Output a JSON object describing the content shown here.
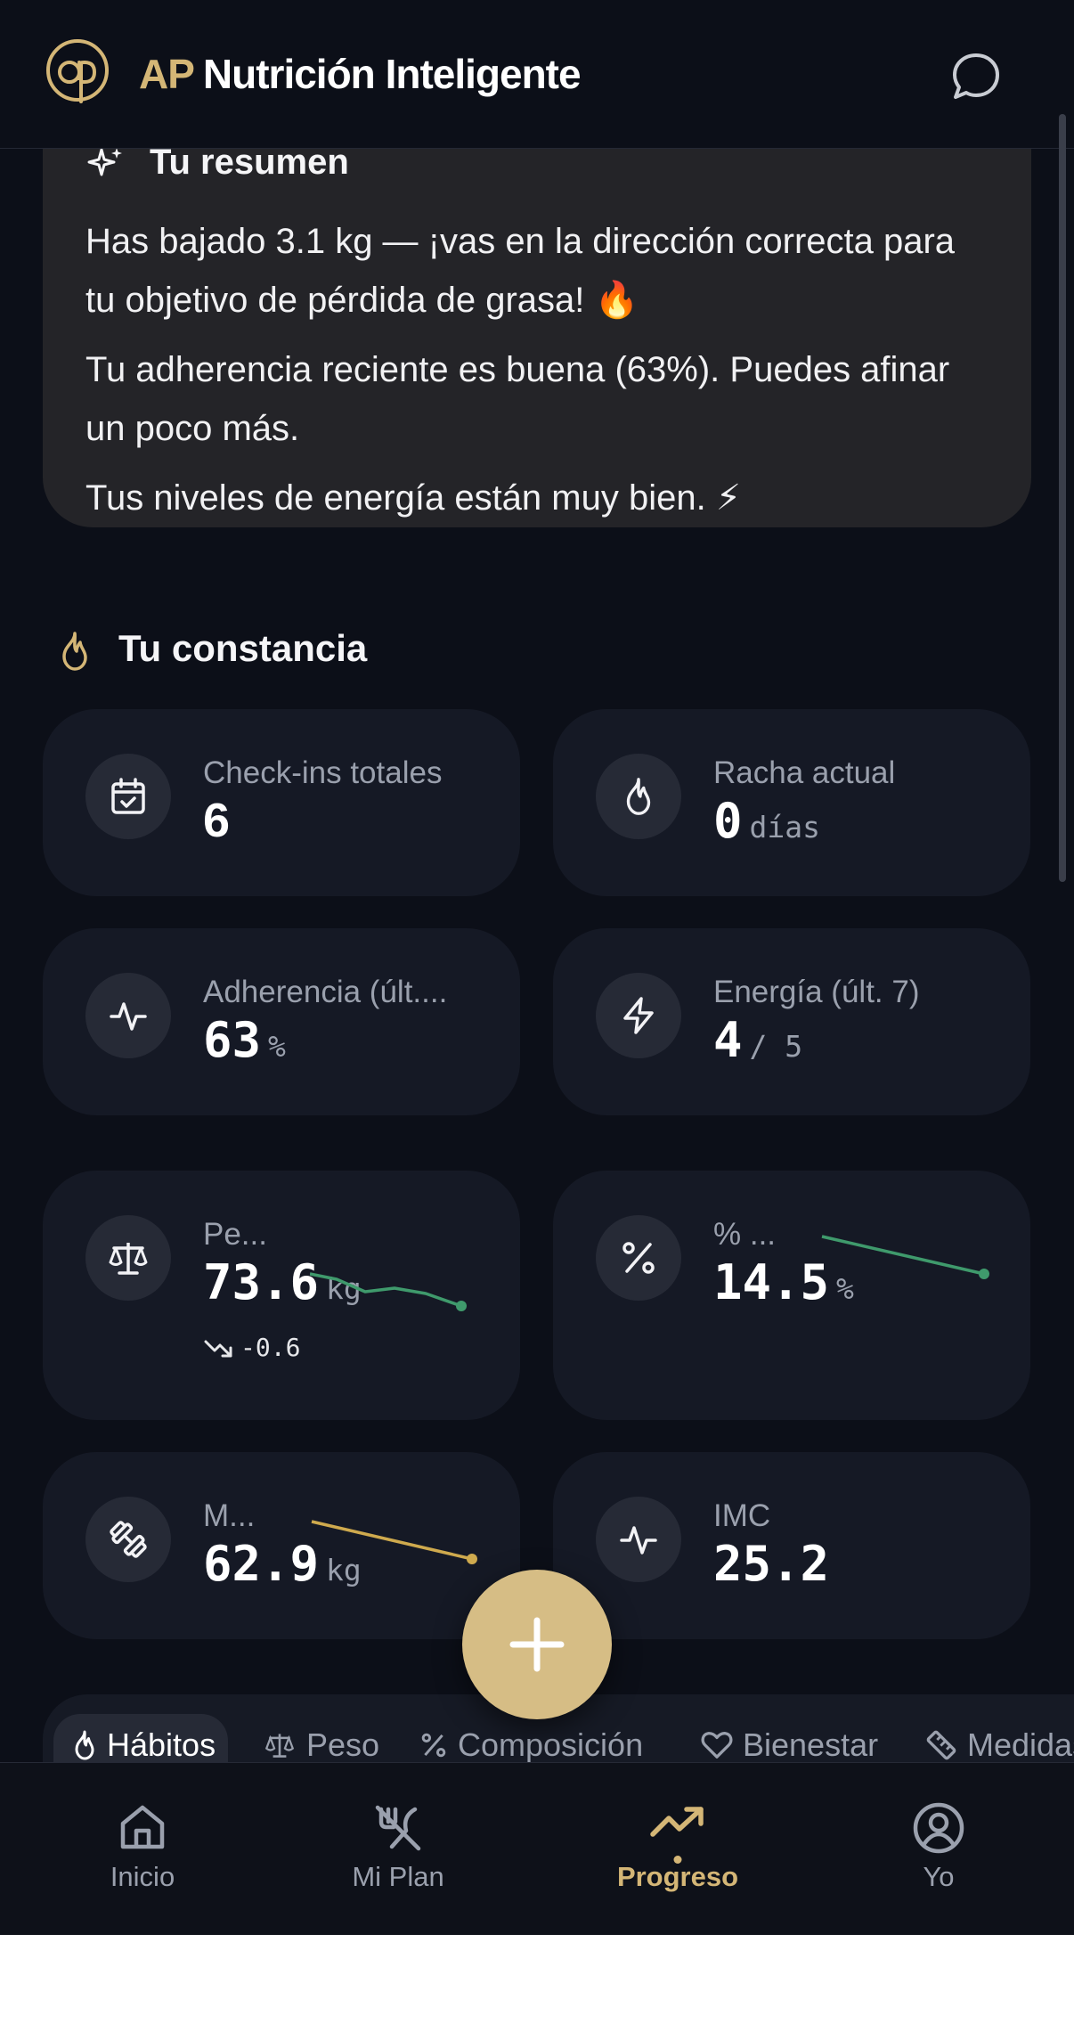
{
  "header": {
    "brand_prefix": "AP",
    "brand_name": "Nutrición Inteligente"
  },
  "summary": {
    "title": "Tu resumen",
    "line1": "Has bajado 3.1 kg — ¡vas en la dirección correcta para tu objetivo de pérdida de grasa! 🔥",
    "line2": "Tu adherencia reciente es buena (63%). Puedes afinar un poco más.",
    "line3": "Tus niveles de energía están muy bien. ⚡"
  },
  "constancia": {
    "title": "Tu constancia",
    "checkins": {
      "label": "Check-ins totales",
      "value": "6"
    },
    "racha": {
      "label": "Racha actual",
      "value": "0",
      "unit": "días"
    },
    "adherencia": {
      "label": "Adherencia (últ....",
      "value": "63",
      "unit": "%"
    },
    "energia": {
      "label": "Energía (últ. 7)",
      "value": "4",
      "unit": "/ 5"
    }
  },
  "metrics": {
    "peso": {
      "label": "Pe...",
      "value": "73.6",
      "unit": "kg",
      "delta": "-0.6",
      "trend_color": "#3f9a6c"
    },
    "grasa": {
      "label": "% ...",
      "value": "14.5",
      "unit": "%",
      "trend_color": "#3f9a6c"
    },
    "musculo": {
      "label": "M...",
      "value": "62.9",
      "unit": "kg",
      "trend_color": "#cfaa4e"
    },
    "imc": {
      "label": "IMC",
      "value": "25.2"
    }
  },
  "tabs": [
    "Hábitos",
    "Peso",
    "Composición",
    "Bienestar",
    "Medidas"
  ],
  "nav": {
    "inicio": "Inicio",
    "plan": "Mi Plan",
    "progreso": "Progreso",
    "yo": "Yo"
  },
  "colors": {
    "accent": "#d4b676",
    "background": "#0c0f18",
    "card": "#151925"
  }
}
